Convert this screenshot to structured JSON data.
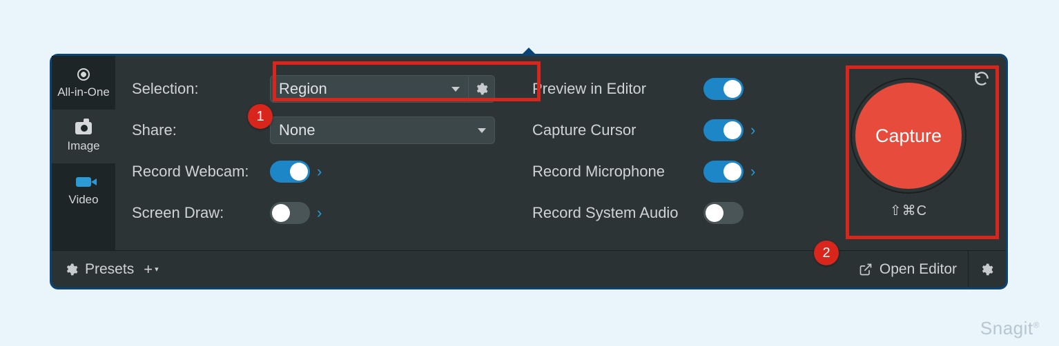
{
  "sidebar": {
    "items": [
      {
        "label": "All-in-One"
      },
      {
        "label": "Image"
      },
      {
        "label": "Video"
      }
    ]
  },
  "settings_left": {
    "selection_label": "Selection:",
    "selection_value": "Region",
    "share_label": "Share:",
    "share_value": "None",
    "webcam_label": "Record Webcam:",
    "screendraw_label": "Screen Draw:"
  },
  "settings_right": {
    "preview_label": "Preview in Editor",
    "cursor_label": "Capture Cursor",
    "mic_label": "Record Microphone",
    "sysaudio_label": "Record System Audio"
  },
  "toggles": {
    "webcam": true,
    "screendraw": false,
    "preview": true,
    "cursor": true,
    "mic": true,
    "sysaudio": false
  },
  "capture": {
    "button_label": "Capture",
    "shortcut": "⇧⌘C"
  },
  "bottom": {
    "presets_label": "Presets",
    "open_editor_label": "Open Editor"
  },
  "annotations": {
    "badge1": "1",
    "badge2": "2"
  },
  "watermark": "Snagit"
}
